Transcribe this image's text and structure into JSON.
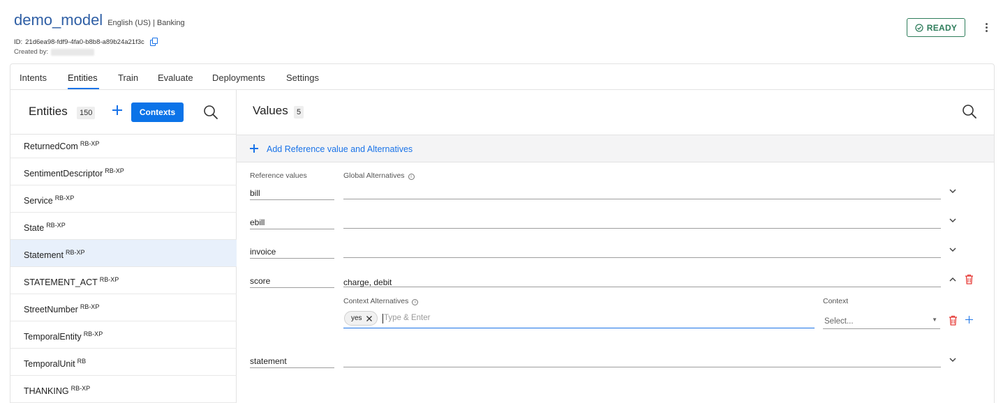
{
  "header": {
    "model_name": "demo_model",
    "model_meta": "English (US) | Banking",
    "id_label": "ID:",
    "id_value": "21d6ea98-fdf9-4fa0-b8b8-a89b24a21f3c",
    "created_by_label": "Created by:",
    "status_label": "READY"
  },
  "tabs": [
    "Intents",
    "Entities",
    "Train",
    "Evaluate",
    "Deployments",
    "Settings"
  ],
  "active_tab": "Entities",
  "entities_panel": {
    "title": "Entities",
    "count": "150",
    "contexts_button": "Contexts",
    "items": [
      {
        "name": "ReturnedCom",
        "tag": "RB-XP"
      },
      {
        "name": "SentimentDescriptor",
        "tag": "RB-XP"
      },
      {
        "name": "Service",
        "tag": "RB-XP"
      },
      {
        "name": "State",
        "tag": "RB-XP"
      },
      {
        "name": "Statement",
        "tag": "RB-XP"
      },
      {
        "name": "STATEMENT_ACT",
        "tag": "RB-XP"
      },
      {
        "name": "StreetNumber",
        "tag": "RB-XP"
      },
      {
        "name": "TemporalEntity",
        "tag": "RB-XP"
      },
      {
        "name": "TemporalUnit",
        "tag": "RB"
      },
      {
        "name": "THANKING",
        "tag": "RB-XP"
      }
    ],
    "selected": "Statement"
  },
  "values_panel": {
    "title": "Values",
    "count": "5",
    "add_label": "Add Reference value and Alternatives",
    "col_reference": "Reference values",
    "col_global": "Global Alternatives",
    "col_context_alt": "Context Alternatives",
    "col_context": "Context",
    "rows": [
      {
        "reference": "bill",
        "alternatives": ""
      },
      {
        "reference": "ebill",
        "alternatives": ""
      },
      {
        "reference": "invoice",
        "alternatives": ""
      },
      {
        "reference": "score",
        "alternatives": "charge, debit"
      },
      {
        "reference": "statement",
        "alternatives": ""
      }
    ],
    "expanded_row": {
      "chips": [
        "yes"
      ],
      "input_placeholder": "Type & Enter",
      "context_select_value": "Select..."
    }
  },
  "colors": {
    "accent": "#1a73e8",
    "title": "#2f5fa5",
    "ready": "#2e7d5b",
    "danger": "#e53935",
    "selected_row": "#e8f0fb"
  }
}
